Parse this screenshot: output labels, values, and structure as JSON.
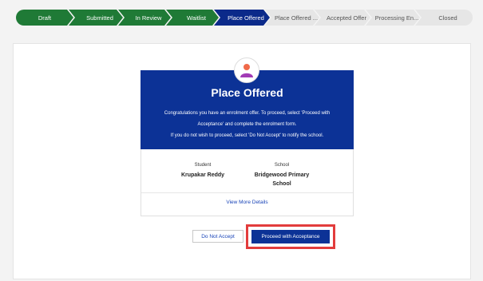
{
  "stepper": {
    "steps": [
      {
        "label": "Draft",
        "state": "done"
      },
      {
        "label": "Submitted",
        "state": "done"
      },
      {
        "label": "In Review",
        "state": "done"
      },
      {
        "label": "Waitlist",
        "state": "done"
      },
      {
        "label": "Place Offered",
        "state": "current"
      },
      {
        "label": "Place Offered ...",
        "state": "todo"
      },
      {
        "label": "Accepted Offer",
        "state": "todo"
      },
      {
        "label": "Processing En...",
        "state": "todo"
      },
      {
        "label": "Closed",
        "state": "todo"
      }
    ]
  },
  "offer": {
    "avatar_icon": "user-avatar-icon",
    "title": "Place Offered",
    "message_1": "Congratulations you have an enrolment offer. To proceed, select 'Proceed with",
    "message_2": "Acceptance' and complete the enrolment form.",
    "message_3": "If you do not wish to proceed, select 'Do Not Accept' to notify the school.",
    "student_label": "Student",
    "student_name": "Krupakar Reddy",
    "school_label": "School",
    "school_name_1": "Bridgewood Primary",
    "school_name_2": "School",
    "view_more": "View More Details"
  },
  "actions": {
    "decline_label": "Do Not Accept",
    "accept_label": "Proceed with Acceptance"
  },
  "colors": {
    "done": "#1f7a36",
    "current": "#0b2a8a",
    "header": "#0c3296",
    "highlight": "#e23c3c"
  }
}
